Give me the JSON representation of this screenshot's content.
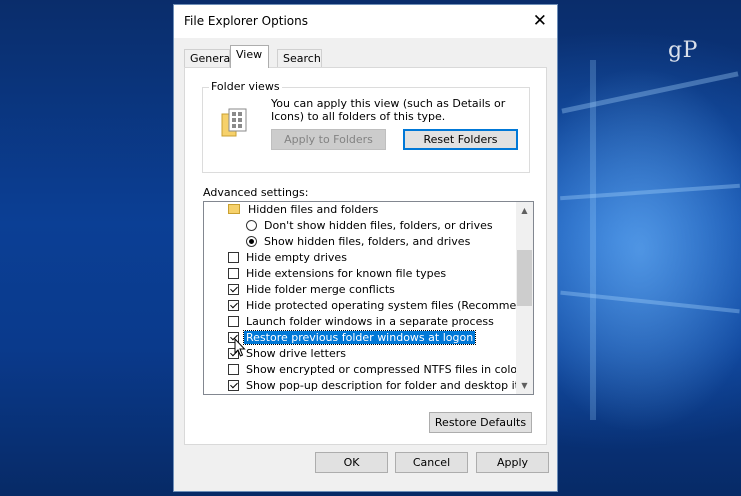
{
  "watermark": "gP",
  "dialog": {
    "title": "File Explorer Options",
    "close_glyph": "✕",
    "tabs": [
      {
        "label": "General"
      },
      {
        "label": "View"
      },
      {
        "label": "Search"
      }
    ],
    "folder_views": {
      "legend": "Folder views",
      "description": "You can apply this view (such as Details or Icons) to all folders of this type.",
      "apply_button": "Apply to Folders",
      "reset_button": "Reset Folders"
    },
    "advanced_label": "Advanced settings:",
    "tree_items": [
      {
        "type": "folder",
        "label": "Hidden files and folders"
      },
      {
        "type": "radio",
        "checked": false,
        "label": "Don't show hidden files, folders, or drives"
      },
      {
        "type": "radio",
        "checked": true,
        "label": "Show hidden files, folders, and drives"
      },
      {
        "type": "checkbox",
        "checked": false,
        "label": "Hide empty drives"
      },
      {
        "type": "checkbox",
        "checked": false,
        "label": "Hide extensions for known file types"
      },
      {
        "type": "checkbox",
        "checked": true,
        "label": "Hide folder merge conflicts"
      },
      {
        "type": "checkbox",
        "checked": true,
        "label": "Hide protected operating system files (Recommended)"
      },
      {
        "type": "checkbox",
        "checked": false,
        "label": "Launch folder windows in a separate process"
      },
      {
        "type": "checkbox",
        "checked": true,
        "label": "Restore previous folder windows at logon",
        "selected": true
      },
      {
        "type": "checkbox",
        "checked": true,
        "label": "Show drive letters"
      },
      {
        "type": "checkbox",
        "checked": false,
        "label": "Show encrypted or compressed NTFS files in color"
      },
      {
        "type": "checkbox",
        "checked": true,
        "label": "Show pop-up description for folder and desktop items"
      }
    ],
    "restore_defaults": "Restore Defaults",
    "ok": "OK",
    "cancel": "Cancel",
    "apply": "Apply"
  },
  "colors": {
    "selection": "#0078d7",
    "dialog_bg": "#f0f0f0",
    "desktop": "#0b3f95"
  }
}
